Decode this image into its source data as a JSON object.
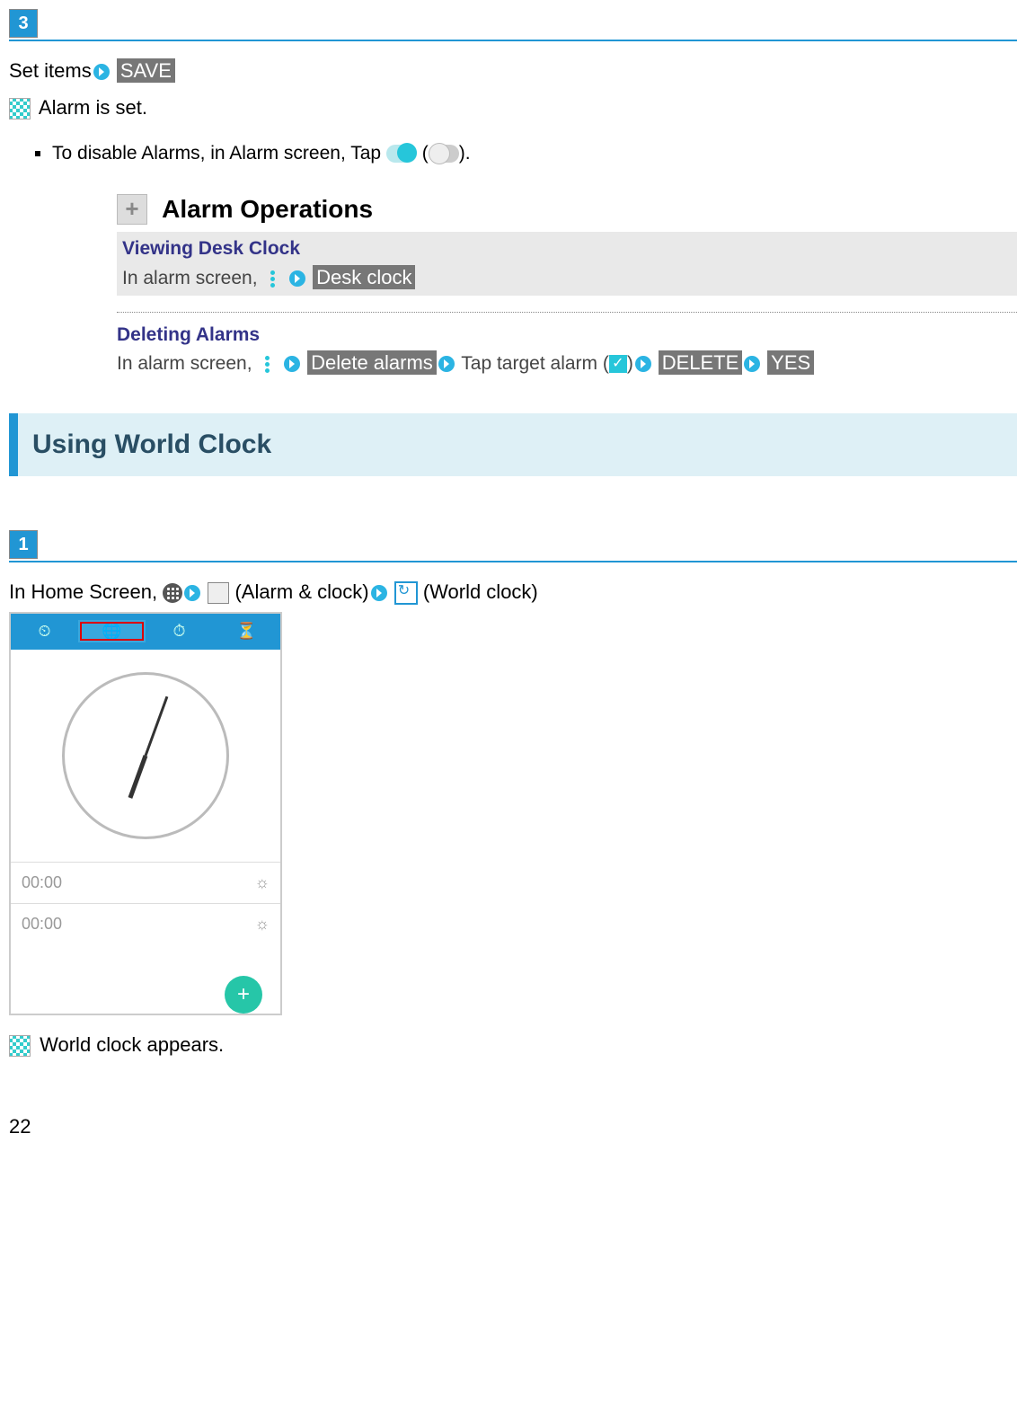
{
  "step3": {
    "badge": "3",
    "line1_pre": "Set items",
    "save": "SAVE",
    "result": "Alarm is set.",
    "bullet_pre": "To disable Alarms, in Alarm screen, Tap ",
    "bullet_paren_open": " (",
    "bullet_paren_close": ")."
  },
  "ops": {
    "title": "Alarm Operations",
    "view": {
      "title": "Viewing Desk Clock",
      "pre": "In alarm screen, ",
      "label": "Desk clock"
    },
    "del": {
      "title": "Deleting Alarms",
      "pre": "In alarm screen, ",
      "label_delete_alarms": "Delete alarms",
      "tap_pre": " Tap target alarm (",
      "tap_post": ")",
      "delete": "DELETE",
      "yes": "YES"
    }
  },
  "section": {
    "world": "Using World Clock"
  },
  "step1": {
    "badge": "1",
    "pre": "In Home Screen, ",
    "alarm_clock": " (Alarm & clock)",
    "world_clock": " (World clock)",
    "result": "World clock appears."
  },
  "screenshot": {
    "t1": "⏲",
    "t2": "🌐",
    "t3": "⏱",
    "t4": "⏳",
    "row1": "00:00",
    "row2": "00:00"
  },
  "page": "22"
}
